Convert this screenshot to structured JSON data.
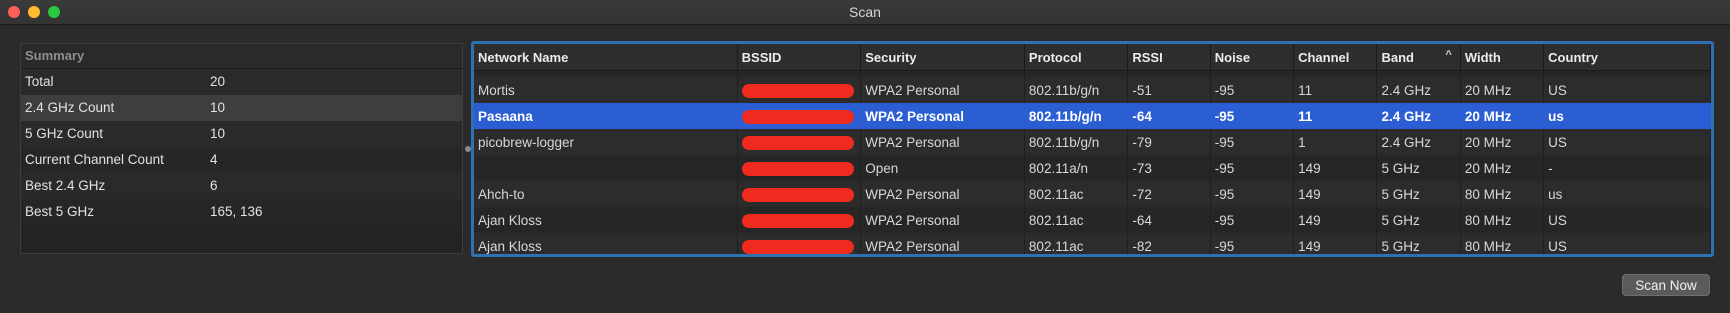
{
  "window": {
    "title": "Scan"
  },
  "summary": {
    "header": "Summary",
    "rows": [
      {
        "label": "Total",
        "value": "20"
      },
      {
        "label": "2.4 GHz Count",
        "value": "10"
      },
      {
        "label": "5 GHz Count",
        "value": "10"
      },
      {
        "label": "Current Channel Count",
        "value": "4"
      },
      {
        "label": "Best 2.4 GHz",
        "value": "6"
      },
      {
        "label": "Best 5 GHz",
        "value": "165, 136"
      }
    ]
  },
  "table": {
    "columns": [
      "Network Name",
      "BSSID",
      "Security",
      "Protocol",
      "RSSI",
      "Noise",
      "Channel",
      "Band",
      "Width",
      "Country"
    ],
    "sort_column": "Band",
    "sort_direction": "ascending",
    "redaction_color": "#ee2b1e",
    "selection_color": "#2c5ed3",
    "rows": [
      {
        "name": "Mortis",
        "security": "WPA2 Personal",
        "protocol": "802.11b/g/n",
        "rssi": "-51",
        "noise": "-95",
        "channel": "11",
        "band": "2.4 GHz",
        "width": "20 MHz",
        "country": "US"
      },
      {
        "name": "Pasaana",
        "security": "WPA2 Personal",
        "protocol": "802.11b/g/n",
        "rssi": "-64",
        "noise": "-95",
        "channel": "11",
        "band": "2.4 GHz",
        "width": "20 MHz",
        "country": "us"
      },
      {
        "name": "picobrew-logger",
        "security": "WPA2 Personal",
        "protocol": "802.11b/g/n",
        "rssi": "-79",
        "noise": "-95",
        "channel": "1",
        "band": "2.4 GHz",
        "width": "20 MHz",
        "country": "US"
      },
      {
        "name": "",
        "security": "Open",
        "protocol": "802.11a/n",
        "rssi": "-73",
        "noise": "-95",
        "channel": "149",
        "band": "5 GHz",
        "width": "20 MHz",
        "country": "-"
      },
      {
        "name": "Ahch-to",
        "security": "WPA2 Personal",
        "protocol": "802.11ac",
        "rssi": "-72",
        "noise": "-95",
        "channel": "149",
        "band": "5 GHz",
        "width": "80 MHz",
        "country": "us"
      },
      {
        "name": "Ajan Kloss",
        "security": "WPA2 Personal",
        "protocol": "802.11ac",
        "rssi": "-64",
        "noise": "-95",
        "channel": "149",
        "band": "5 GHz",
        "width": "80 MHz",
        "country": "US"
      },
      {
        "name": "Ajan Kloss",
        "security": "WPA2 Personal",
        "protocol": "802.11ac",
        "rssi": "-82",
        "noise": "-95",
        "channel": "149",
        "band": "5 GHz",
        "width": "80 MHz",
        "country": "US"
      }
    ]
  },
  "scan_button": {
    "label": "Scan Now"
  }
}
